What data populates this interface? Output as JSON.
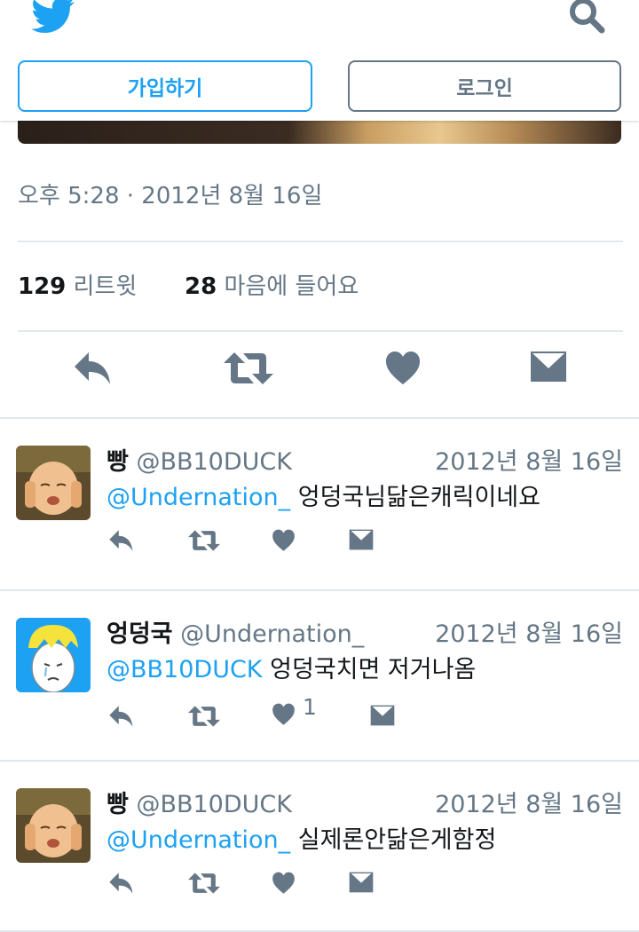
{
  "header": {
    "signup_label": "가입하기",
    "login_label": "로그인",
    "logo_icon": "twitter-bird-icon",
    "search_icon": "search-icon"
  },
  "tweet": {
    "timestamp": "오후 5:28 · 2012년 8월 16일",
    "retweet_count": "129",
    "retweet_label": "리트윗",
    "like_count": "28",
    "like_label": "마음에 들어요"
  },
  "colors": {
    "accent": "#1da1f2",
    "muted": "#657786",
    "divider": "#e1e8ed"
  },
  "replies": [
    {
      "name": "빵",
      "handle": "@BB10DUCK",
      "date": "2012년 8월 16일",
      "mention": "@Undernation_",
      "text": "엉덩국님닮은캐릭이네요",
      "like_count": ""
    },
    {
      "name": "엉덩국",
      "handle": "@Undernation_",
      "date": "2012년 8월 16일",
      "mention": "@BB10DUCK",
      "text": "엉덩국치면 저거나옴",
      "like_count": "1"
    },
    {
      "name": "빵",
      "handle": "@BB10DUCK",
      "date": "2012년 8월 16일",
      "mention": "@Undernation_",
      "text": "실제론안닮은게함정",
      "like_count": ""
    }
  ]
}
